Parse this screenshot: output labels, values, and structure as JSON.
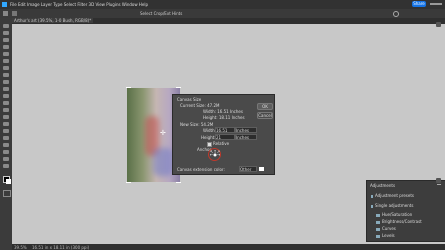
{
  "menubar": {
    "items": [
      "File",
      "Edit",
      "Image",
      "Layer",
      "Type",
      "Select",
      "Filter",
      "3D",
      "View",
      "Plugins",
      "Window",
      "Help"
    ],
    "share_label": "Share"
  },
  "options": {
    "label": "Select Crop/Ext Hints"
  },
  "tab": {
    "label": "Arthur's art (39.5%, 1-0 Bush, RGB/8)*"
  },
  "dialog": {
    "title": "Canvas Size",
    "current_size_label": "Current Size: 47.2M",
    "current_width": "Width:  16.51 Inches",
    "current_height": "Height:  18.11 Inches",
    "new_size_label": "New Size: 54.2M",
    "width_label": "Width:",
    "width_value": "16.51",
    "height_label": "Height:",
    "height_value": "21",
    "unit_inches": "Inches",
    "relative_label": "Relative",
    "anchor_label": "Anchor:",
    "extension_label": "Canvas extension color:",
    "extension_value": "Other",
    "ok_label": "OK",
    "cancel_label": "Cancel"
  },
  "adjustments": {
    "title": "Adjustments",
    "items": [
      "Adjustment presets",
      "Single adjustments",
      "Hue/Saturation",
      "Brightness/Contrast",
      "Curves",
      "Levels"
    ]
  },
  "status": {
    "zoom": "39.5%",
    "info": "16.51 in x 18.11 in (300 ppi)"
  }
}
